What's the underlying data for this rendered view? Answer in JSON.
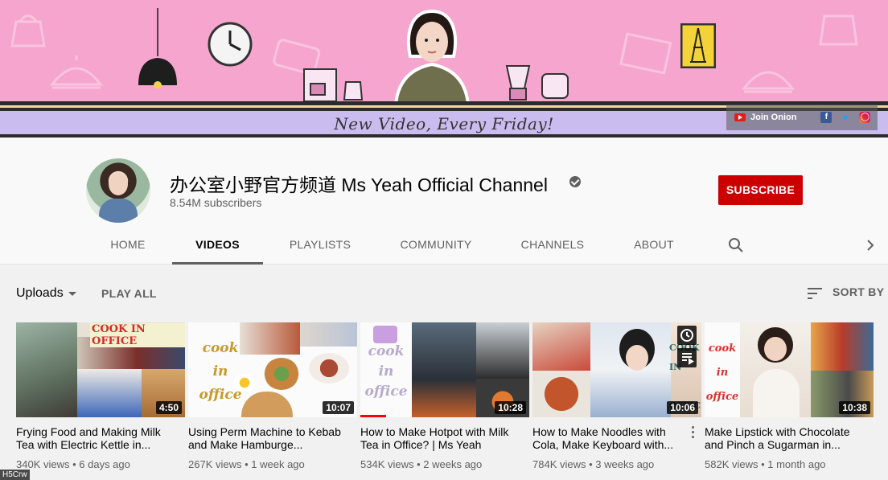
{
  "banner": {
    "tagline": "New Video, Every Friday!",
    "join_label": "Join Onion",
    "colors": {
      "pink": "#f6a5cf",
      "lavender": "#cbbcef"
    },
    "social_icons": [
      "youtube-icon",
      "facebook-icon",
      "twitter-icon",
      "instagram-icon"
    ]
  },
  "channel": {
    "name": "办公室小野官方频道 Ms Yeah Official Channel",
    "subscribers": "8.54M subscribers",
    "subscribe_label": "SUBSCRIBE",
    "verified_icon": "verified-check-icon"
  },
  "tabs": [
    {
      "label": "HOME"
    },
    {
      "label": "VIDEOS",
      "active": true
    },
    {
      "label": "PLAYLISTS"
    },
    {
      "label": "COMMUNITY"
    },
    {
      "label": "CHANNELS"
    },
    {
      "label": "ABOUT"
    }
  ],
  "toolbar": {
    "uploads_label": "Uploads",
    "play_all_label": "PLAY ALL",
    "sort_by_label": "SORT BY"
  },
  "videos": [
    {
      "title": "Frying Food and Making Milk Tea with Electric Kettle in...",
      "views": "340K views",
      "age": "6 days ago",
      "duration": "4:50",
      "thumb_text": "COOK IN OFFICE"
    },
    {
      "title": "Using Perm Machine to Kebab and Make Hamburge...",
      "views": "267K views",
      "age": "1 week ago",
      "duration": "10:07",
      "thumb_text": "cook in office"
    },
    {
      "title": "How to Make Hotpot with Milk Tea in Office? | Ms Yeah",
      "views": "534K views",
      "age": "2 weeks ago",
      "duration": "10:28",
      "thumb_text": "cook in office",
      "watched": 0.15
    },
    {
      "title": "How to Make Noodles with Cola, Make Keyboard with...",
      "views": "784K views",
      "age": "3 weeks ago",
      "duration": "10:06",
      "thumb_text": "COOK IN OFFICE"
    },
    {
      "title": "Make Lipstick with Chocolate and Pinch a Sugarman in...",
      "views": "582K views",
      "age": "1 month ago",
      "duration": "10:38",
      "thumb_text": "cook in office"
    }
  ],
  "corner_tag": "H5Crw",
  "colors": {
    "subscribe": "#cc0000",
    "text_primary": "#030303",
    "text_secondary": "#606060"
  }
}
